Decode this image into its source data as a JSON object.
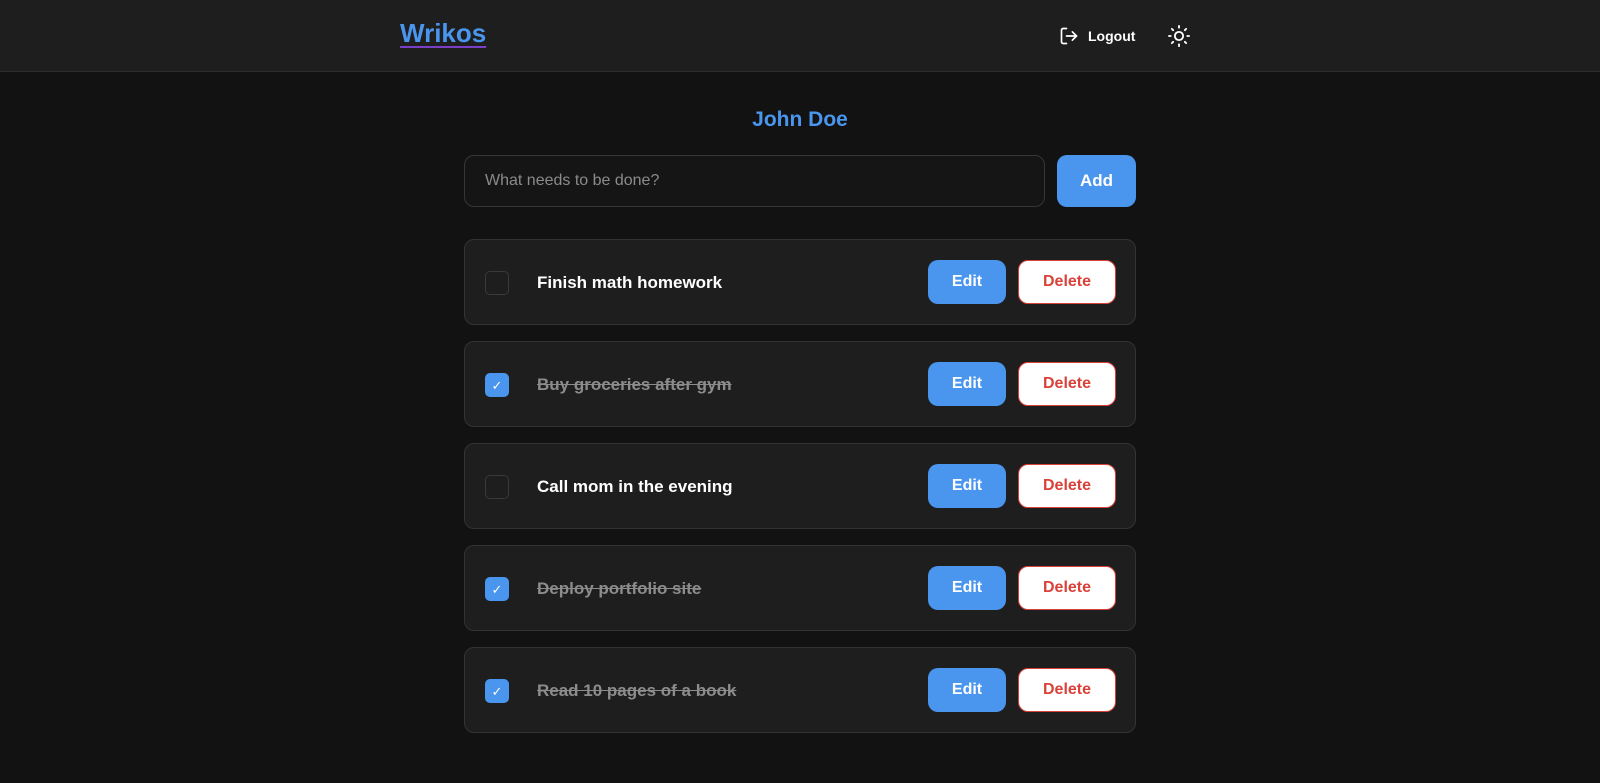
{
  "navbar": {
    "brand": "Wrikos",
    "logout_label": "Logout",
    "logout_icon": "logout-icon",
    "theme_icon": "sun-icon"
  },
  "user": {
    "name": "John Doe"
  },
  "add_form": {
    "placeholder": "What needs to be done?",
    "value": "",
    "add_label": "Add"
  },
  "todos": [
    {
      "text": "Finish math homework",
      "done": false,
      "edit_label": "Edit",
      "delete_label": "Delete"
    },
    {
      "text": "Buy groceries after gym",
      "done": true,
      "edit_label": "Edit",
      "delete_label": "Delete"
    },
    {
      "text": "Call mom in the evening",
      "done": false,
      "edit_label": "Edit",
      "delete_label": "Delete"
    },
    {
      "text": "Deploy portfolio site",
      "done": true,
      "edit_label": "Edit",
      "delete_label": "Delete"
    },
    {
      "text": "Read 10 pages of a book",
      "done": true,
      "edit_label": "Edit",
      "delete_label": "Delete"
    }
  ],
  "colors": {
    "accent": "#4a95ee",
    "danger": "#d9423a",
    "background": "#121212",
    "surface": "#1e1e1e"
  }
}
